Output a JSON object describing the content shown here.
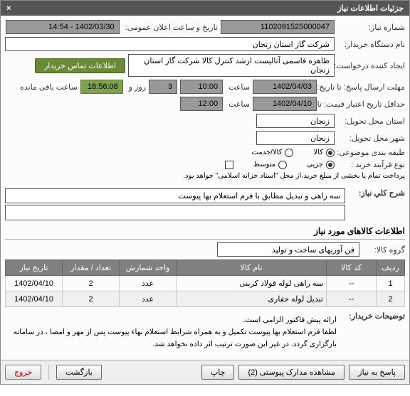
{
  "header": {
    "title": "جزئیات اطلاعات نیاز",
    "close": "×"
  },
  "f": {
    "reqNoLbl": "شماره نیاز:",
    "reqNo": "1102091525000047",
    "annDateLbl": "تاریخ و ساعت اعلان عمومی:",
    "annDate": "1402/03/30 - 14:54",
    "buyerOrgLbl": "نام دستگاه خریدار:",
    "buyerOrg": "شرکت گاز استان زنجان",
    "creatorLbl": "ایجاد کننده درخواست:",
    "creator": "طاهره قاسمی  آنالیست ارشد کنترل کالا شرکت گاز استان زنجان",
    "contactBtn": "اطلاعات تماس خریدار",
    "deadlineLbl": "مهلت ارسال پاسخ: تا تاریخ:",
    "deadlineDate": "1402/04/03",
    "timeLbl": "ساعت",
    "deadlineTime": "10:00",
    "daysLbl": "روز و",
    "days": "3",
    "remainLbl": "ساعت باقی مانده",
    "remain": "18:56:08",
    "validLbl": "حداقل تاریخ اعتبار قیمت: تا تاریخ:",
    "validDate": "1402/04/10",
    "validTime": "12:00",
    "delivProvLbl": "استان محل تحویل:",
    "delivProv": "زنجان",
    "delivCityLbl": "شهر محل تحویل:",
    "delivCity": "زنجان",
    "catLbl": "طبقه بندی موضوعی:",
    "cat1": "کالا",
    "cat2": "کالا/خدمت",
    "buyTypeLbl": "نوع فرآیند خرید :",
    "bt1": "جزیی",
    "bt2": "متوسط",
    "payNote": "پرداخت تمام یا بخشی از مبلغ خرید،از محل \"اسناد خزانه اسلامی\" خواهد بود.",
    "descLbl": "شرح کلي نياز:",
    "desc": "سه راهی و تبدیل مطابق با فرم استعلام بها پیوست",
    "itemsTitle": "اطلاعات کالاهای مورد نیاز",
    "groupLbl": "گروه کالا:",
    "group": "فن آوریهای ساخت و تولید",
    "cols": {
      "row": "ردیف",
      "code": "کد کالا",
      "name": "نام کالا",
      "unit": "واحد شمارش",
      "qty": "تعداد / مقدار",
      "date": "تاریخ نیاز"
    },
    "rows": [
      {
        "row": "1",
        "code": "--",
        "name": "سه راهی لوله فولاد کربنی",
        "unit": "عدد",
        "qty": "2",
        "date": "1402/04/10"
      },
      {
        "row": "2",
        "code": "--",
        "name": "تبدیل لوله حفاری",
        "unit": "عدد",
        "qty": "2",
        "date": "1402/04/10"
      }
    ],
    "buyerNoteLbl": "توضیحات خریدار:",
    "buyerNote": "ارائه پیش فاکتور الزامی است.\nلطفا فرم استعلام بها پیوست تکمیل و به همراه شرایط استعلام بهاء  پیوست پس از مهر و امضا ، در سامانه بارگزاری گردد. در غیر این صورت ترتیب اثر داده نخواهد شد."
  },
  "btns": {
    "reply": "پاسخ به نیاز",
    "attach": "مشاهده مدارک پیوستی (2)",
    "print": "چاپ",
    "back": "بازگشت",
    "exit": "خروج"
  }
}
